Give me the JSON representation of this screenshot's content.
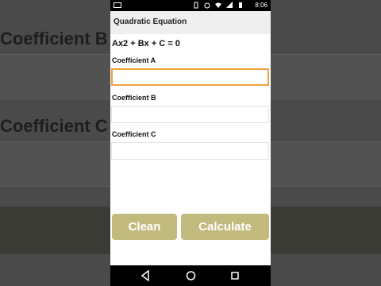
{
  "app": {
    "title": "Quadratic Equation",
    "equation": "Ax2 + Bx + C = 0"
  },
  "status_bar": {
    "time": "8:06",
    "icons": [
      "cast-icon",
      "vibrate-icon",
      "alarm-icon",
      "wifi-icon",
      "signal-icon",
      "battery-icon"
    ]
  },
  "form": {
    "coef_a": {
      "label": "Coefficient A",
      "value": "",
      "placeholder": ""
    },
    "coef_b": {
      "label": "Coefficient B",
      "value": "",
      "placeholder": ""
    },
    "coef_c": {
      "label": "Coefficient C",
      "value": "",
      "placeholder": ""
    }
  },
  "buttons": {
    "clean": "Clean",
    "calculate": "Calculate"
  },
  "navbar": {
    "icons": [
      "back-icon",
      "home-icon",
      "recents-icon"
    ]
  },
  "colors": {
    "button_bg": "#c3ba7d",
    "focus_border": "#f0a040",
    "appbar_bg": "#efefef"
  }
}
